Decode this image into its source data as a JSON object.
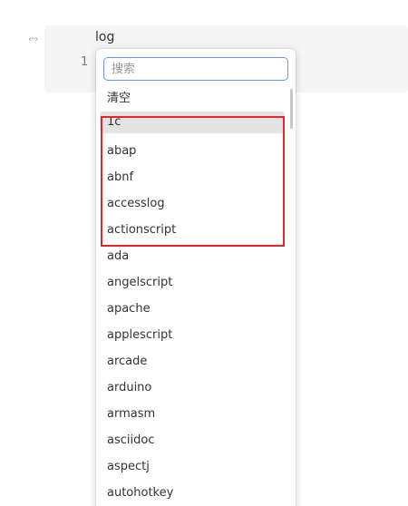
{
  "editor": {
    "block_handle": "‹··›",
    "language_label": "log",
    "line_number": "1"
  },
  "dropdown": {
    "search_placeholder": "搜索",
    "clear_label": "清空",
    "items": [
      "1c",
      "abap",
      "abnf",
      "accesslog",
      "actionscript",
      "ada",
      "angelscript",
      "apache",
      "applescript",
      "arcade",
      "arduino",
      "armasm",
      "asciidoc",
      "aspectj",
      "autohotkey"
    ],
    "highlighted_item": "1c"
  },
  "colors": {
    "highlight_bg": "#e3e3e3",
    "annotation_border": "#e02828",
    "input_focus_border": "#6b8ff0"
  }
}
